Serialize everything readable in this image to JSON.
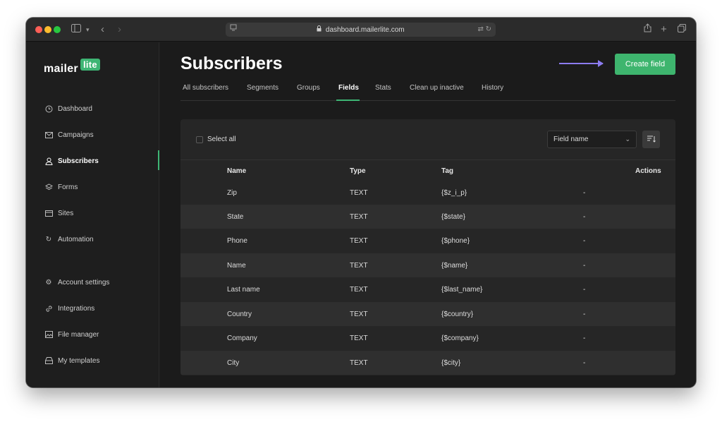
{
  "browser": {
    "url": "dashboard.mailerlite.com"
  },
  "logo": {
    "text": "mailer",
    "badge": "lite"
  },
  "sidebar": {
    "items": [
      {
        "label": "Dashboard",
        "icon": "clock-icon"
      },
      {
        "label": "Campaigns",
        "icon": "envelope-icon"
      },
      {
        "label": "Subscribers",
        "icon": "user-icon",
        "active": true
      },
      {
        "label": "Forms",
        "icon": "layers-icon"
      },
      {
        "label": "Sites",
        "icon": "browser-icon"
      },
      {
        "label": "Automation",
        "icon": "refresh-icon"
      }
    ],
    "bottom_items": [
      {
        "label": "Account settings",
        "icon": "gear-icon"
      },
      {
        "label": "Integrations",
        "icon": "link-icon"
      },
      {
        "label": "File manager",
        "icon": "image-icon"
      },
      {
        "label": "My templates",
        "icon": "inbox-icon"
      }
    ]
  },
  "page": {
    "title": "Subscribers",
    "create_button": "Create field"
  },
  "tabs": [
    "All subscribers",
    "Segments",
    "Groups",
    "Fields",
    "Stats",
    "Clean up inactive",
    "History"
  ],
  "active_tab": "Fields",
  "toolbar": {
    "select_all": "Select all",
    "sort_select": "Field name"
  },
  "table": {
    "headers": {
      "name": "Name",
      "type": "Type",
      "tag": "Tag",
      "actions": "Actions"
    },
    "rows": [
      {
        "name": "Zip",
        "type": "TEXT",
        "tag": "{$z_i_p}",
        "actions": "-"
      },
      {
        "name": "State",
        "type": "TEXT",
        "tag": "{$state}",
        "actions": "-"
      },
      {
        "name": "Phone",
        "type": "TEXT",
        "tag": "{$phone}",
        "actions": "-"
      },
      {
        "name": "Name",
        "type": "TEXT",
        "tag": "{$name}",
        "actions": "-"
      },
      {
        "name": "Last name",
        "type": "TEXT",
        "tag": "{$last_name}",
        "actions": "-"
      },
      {
        "name": "Country",
        "type": "TEXT",
        "tag": "{$country}",
        "actions": "-"
      },
      {
        "name": "Company",
        "type": "TEXT",
        "tag": "{$company}",
        "actions": "-"
      },
      {
        "name": "City",
        "type": "TEXT",
        "tag": "{$city}",
        "actions": "-"
      }
    ]
  },
  "colors": {
    "accent": "#3eb574",
    "arrow": "#8c7cf0",
    "background": "#1b1b1b"
  }
}
